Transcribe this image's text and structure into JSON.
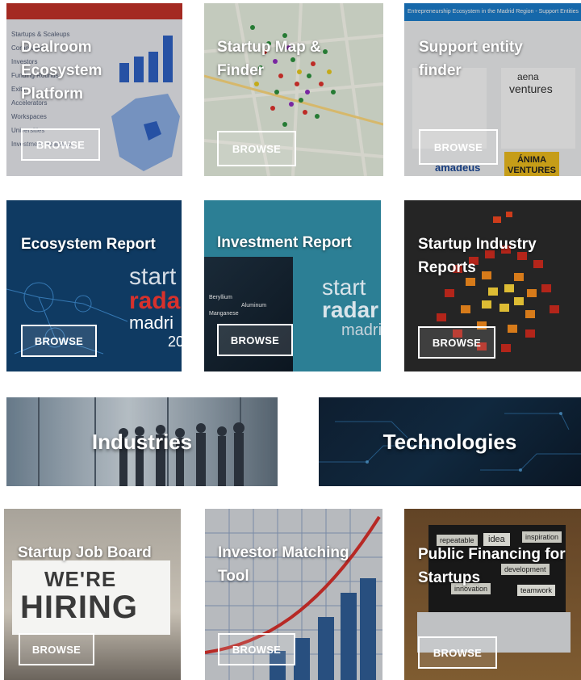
{
  "row1": [
    {
      "title_lines": [
        "Dealroom",
        "Ecosystem",
        "Platform"
      ],
      "button": "BROWSE",
      "menu": [
        "Startups & Scaleups",
        "Corporates",
        "Investors",
        "Funding Rounds",
        "Exits",
        "Accelerators",
        "Workspaces",
        "Universities",
        "Investment Heatmap"
      ]
    },
    {
      "title_lines": [
        "Startup Map &",
        "Finder"
      ],
      "button": "BROWSE"
    },
    {
      "title_lines": [
        "Support entity",
        "finder"
      ],
      "button": "BROWSE",
      "header": "Entrepreneurship Ecosystem in the Madrid Region - Support Entities",
      "logos": [
        "aena",
        "ventures",
        "amadeus",
        "ÁNIMA",
        "VENTURES"
      ]
    }
  ],
  "row2": [
    {
      "title": "Ecosystem Report",
      "button": "BROWSE",
      "brand": [
        "start",
        "radar",
        "madri",
        "20"
      ]
    },
    {
      "title": "Investment Report",
      "button": "BROWSE",
      "brand": [
        "start",
        "radar",
        "madri"
      ],
      "ticker": [
        "Beryllium",
        "Aluminum",
        "Manganese"
      ]
    },
    {
      "title_lines": [
        "Startup Industry",
        "Reports"
      ],
      "button": "BROWSE"
    }
  ],
  "row3": [
    {
      "title": "Industries"
    },
    {
      "title": "Technologies"
    }
  ],
  "row4": [
    {
      "title": "Startup Job Board",
      "button": "BROWSE",
      "sign": [
        "WE'RE",
        "HIRING"
      ]
    },
    {
      "title_lines": [
        "Investor Matching",
        "Tool"
      ],
      "button": "BROWSE"
    },
    {
      "title_lines": [
        "Public Financing for",
        "Startups"
      ],
      "button": "BROWSE",
      "notes": [
        "idea",
        "inspiration",
        "repeatable",
        "teamwork",
        "development",
        "innovation"
      ]
    }
  ],
  "colors": {
    "button_border": "#ffffff",
    "title": "#ffffff",
    "accent_red": "#d83a2b"
  }
}
